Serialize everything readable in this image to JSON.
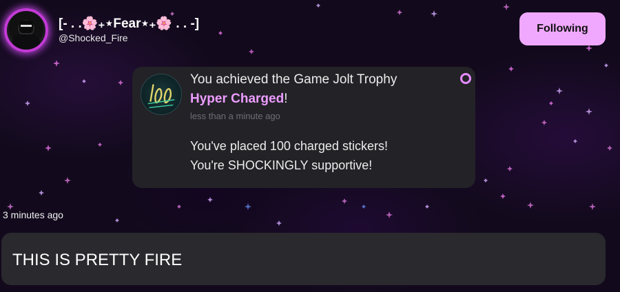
{
  "header": {
    "display_name": "[- . .🌸₊⋆Fear⋆₊🌸 . .  -]",
    "username": "@Shocked_Fire",
    "follow_label": "Following"
  },
  "trophy": {
    "title": "You achieved the Game Jolt Trophy",
    "name": "Hyper Charged",
    "name_suffix": "!",
    "time": "less than a minute ago",
    "description_line1": "You've placed 100 charged stickers!",
    "description_line2": "You're SHOCKINGLY supportive!",
    "image_icon": "trophy-100-icon",
    "status_icon": "ring-icon"
  },
  "post": {
    "time": "3 minutes ago",
    "comment": "THIS IS PRETTY FIRE"
  },
  "colors": {
    "accent": "#f0a8ff",
    "trophy_name": "#ec9cff",
    "card_bg": "#232227",
    "comment_bg": "#2a292e",
    "background": "#120a1c"
  }
}
